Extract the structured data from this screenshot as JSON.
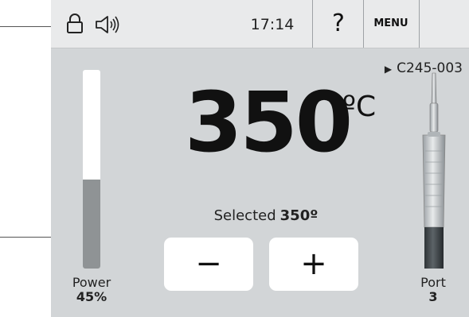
{
  "top_bar": {
    "lock_icon": "lock-icon",
    "sound_icon": "speaker-icon",
    "time": "17:14",
    "help_label": "?",
    "menu_label": "MENU"
  },
  "tool": {
    "id_prefix": "▶",
    "id": "C245-003"
  },
  "temperature": {
    "value": "350",
    "unit": "ºC"
  },
  "selected": {
    "label": "Selected",
    "value": "350º"
  },
  "controls": {
    "decrease_label": "−",
    "increase_label": "+"
  },
  "power": {
    "label": "Power",
    "value_text": "45%",
    "level_percent": 45
  },
  "port": {
    "label": "Port",
    "value": "3"
  },
  "colors": {
    "screen_bg": "#d2d5d7",
    "topbar_bg": "#e9eaeb",
    "power_fill": "#8f9395"
  }
}
